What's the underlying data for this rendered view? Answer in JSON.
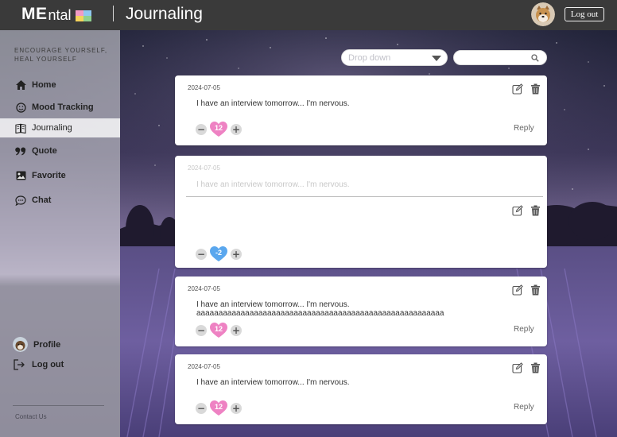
{
  "header": {
    "logo_strong": "ME",
    "logo_light": "ntal",
    "logo_colors": [
      "#f29bc4",
      "#8fc8f0",
      "#f5d35b",
      "#8fd18f"
    ],
    "title": "Journaling",
    "logout_label": "Log out"
  },
  "sidebar": {
    "tagline": "ENCOURAGE YOURSELF, HEAL YOURSELF",
    "items": [
      {
        "label": "Home",
        "icon": "home-icon"
      },
      {
        "label": "Mood Tracking",
        "icon": "smiley-icon"
      },
      {
        "label": "Journaling",
        "icon": "journal-icon",
        "active": true
      },
      {
        "label": "Quote",
        "icon": "quote-icon"
      },
      {
        "label": "Favorite",
        "icon": "image-icon"
      },
      {
        "label": "Chat",
        "icon": "chat-icon"
      }
    ],
    "profile_label": "Profile",
    "logout_label": "Log out",
    "contact": "Contact Us"
  },
  "controls": {
    "dropdown_placeholder": "Drop down",
    "search_value": ""
  },
  "colors": {
    "heart_pink": "#ee82c3",
    "heart_blue": "#5aa7ee"
  },
  "entries": [
    {
      "date": "2024-07-05",
      "text": "I have an interview tomorrow... I'm nervous.",
      "likes": "12",
      "reply": "Reply"
    },
    {
      "date": "2024-07-05",
      "text": "I have an interview tomorrow... I'm nervous.",
      "likes": "-2",
      "editing": true
    },
    {
      "date": "2024-07-05",
      "text": "I have an interview tomorrow... I'm nervous.\naaaaaaaaaaaaaaaaaaaaaaaaaaaaaaaaaaaaaaaaaaaaaaaaaaaaaaaa",
      "likes": "12",
      "reply": "Reply"
    },
    {
      "date": "2024-07-05",
      "text": "I have an interview tomorrow... I'm nervous.",
      "likes": "12",
      "reply": "Reply"
    }
  ]
}
